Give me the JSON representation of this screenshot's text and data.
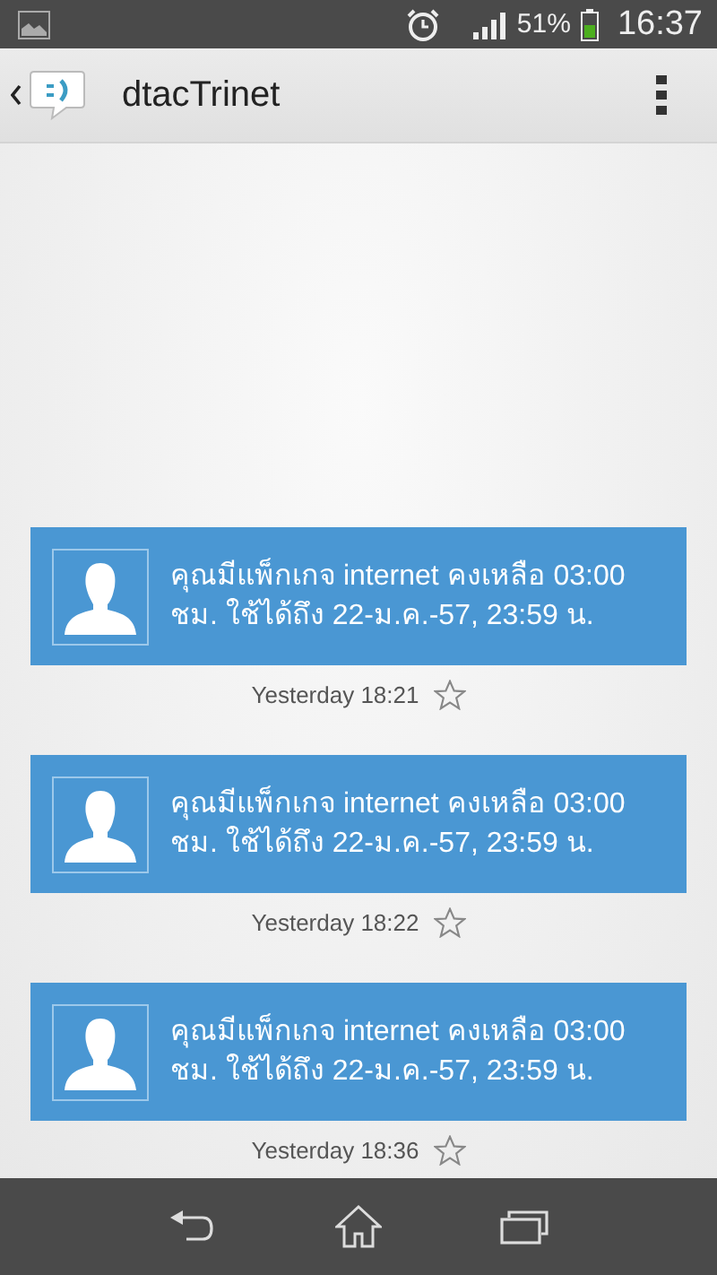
{
  "status_bar": {
    "battery": "51%",
    "time": "16:37"
  },
  "app_bar": {
    "title": "dtacTrinet"
  },
  "messages": [
    {
      "text": "คุณมีแพ็กเกจ internet คงเหลือ 03:00 ชม. ใช้ได้ถึง 22-ม.ค.-57, 23:59 น.",
      "time": "Yesterday 18:21",
      "starred": false
    },
    {
      "text": "คุณมีแพ็กเกจ internet คงเหลือ 03:00 ชม. ใช้ได้ถึง 22-ม.ค.-57, 23:59 น.",
      "time": "Yesterday 18:22",
      "starred": false
    },
    {
      "text": "คุณมีแพ็กเกจ internet คงเหลือ 03:00 ชม. ใช้ได้ถึง 22-ม.ค.-57, 23:59 น.",
      "time": "Yesterday 18:36",
      "starred": false
    }
  ]
}
